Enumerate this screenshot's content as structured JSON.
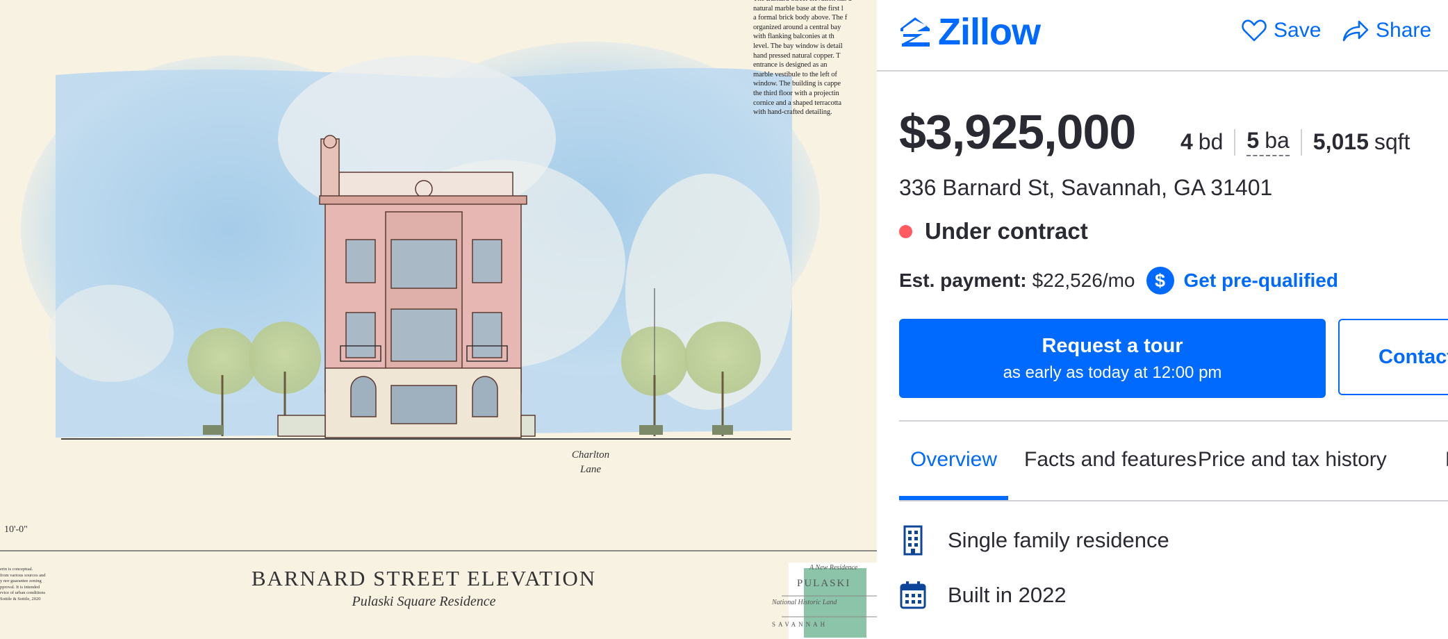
{
  "photo": {
    "description_text": "The Barnard Street elevation has a\nnatural marble base at the first l\na formal brick body above. The f\norganized around a central bay\nwith flanking balconies at th\nlevel. The bay window is detail\nhand pressed natural copper. T\nentrance is designed as an\nmarble vestibule to the left of\nwindow. The building is cappe\nthe third floor with a projectin\ncornice and a shaped terracotta\nwith hand-crafted detailing.",
    "street_label": "Charlton\nLane",
    "scale_label": "10'-0\"",
    "title": "BARNARD STREET ELEVATION",
    "subtitle": "Pulaski Square Residence",
    "disclaimer": "erin is conceptual.\nfrom various sources and\ny nor guarantee zoning\npproval. It is intended\nrvice of urban conditions\nSottile & Sottile, 2020",
    "stamp": {
      "line1": "A New Residence",
      "line2": "PULASKI",
      "line3": "National Historic Land",
      "line4": "SAVANNAH"
    }
  },
  "header": {
    "logo_text": "Zillow",
    "save_label": "Save",
    "share_label": "Share"
  },
  "listing": {
    "price": "$3,925,000",
    "beds_num": "4",
    "beds_unit": "bd",
    "baths_num": "5",
    "baths_unit": "ba",
    "sqft_num": "5,015",
    "sqft_unit": "sqft",
    "address": "336 Barnard St, Savannah, GA 31401",
    "status": "Under contract",
    "status_color": "#ff5a5f",
    "payment_label": "Est. payment:",
    "payment_value": "$22,526/mo",
    "prequal_label": "Get pre-qualified"
  },
  "actions": {
    "tour_title": "Request a tour",
    "tour_sub": "as early as today at 12:00 pm",
    "contact_label": "Contact"
  },
  "tabs": [
    {
      "label": "Overview"
    },
    {
      "label": "Facts and features"
    },
    {
      "label": "Price and tax history"
    },
    {
      "label": "M"
    }
  ],
  "features": [
    {
      "icon": "building-icon",
      "label": "Single family residence"
    },
    {
      "icon": "calendar-icon",
      "label": "Built in 2022"
    }
  ],
  "colors": {
    "brand": "#006aff",
    "text": "#2a2a33",
    "divider": "#d1d1d5"
  }
}
